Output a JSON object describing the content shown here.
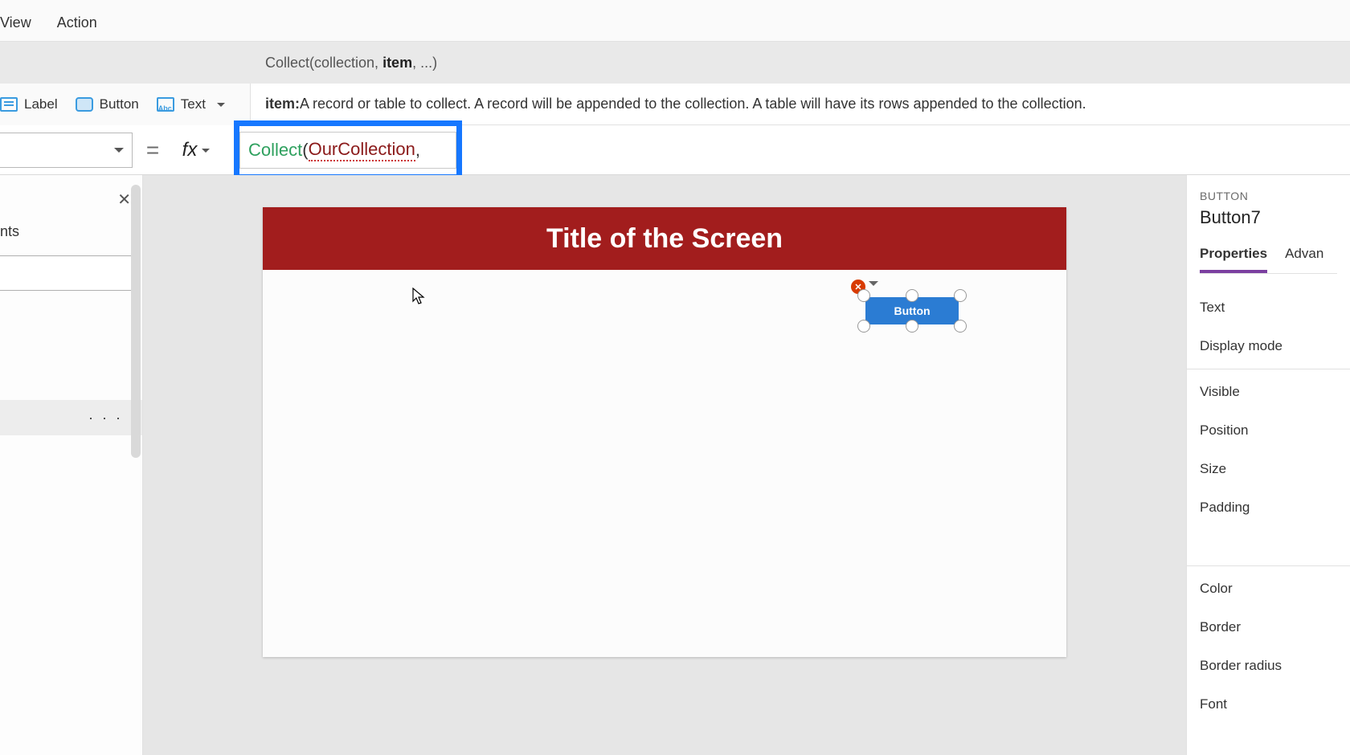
{
  "menubar": {
    "view": "View",
    "action": "Action"
  },
  "ribbon": {
    "label": "Label",
    "button": "Button",
    "text": "Text"
  },
  "intellisense": {
    "sig_pre": "Collect(collection, ",
    "sig_bold": "item",
    "sig_post": ", ...)",
    "param_name": "item:",
    "param_desc": " A record or table to collect. A record will be appended to the collection. A table will have its rows appended to the collection."
  },
  "formula": {
    "equals": "=",
    "fx": "fx",
    "fn": "Collect",
    "open": "(",
    "arg1": "OurCollection",
    "comma": ","
  },
  "treepanel": {
    "heading_fragment": "nts",
    "selected_more": "· · ·"
  },
  "canvas": {
    "screen_title": "Title of the Screen",
    "button_text": "Button"
  },
  "props": {
    "kind": "BUTTON",
    "name": "Button7",
    "tab_properties": "Properties",
    "tab_advanced": "Advan",
    "rows": {
      "text": "Text",
      "display_mode": "Display mode",
      "visible": "Visible",
      "position": "Position",
      "size": "Size",
      "padding": "Padding",
      "color": "Color",
      "border": "Border",
      "border_radius": "Border radius",
      "font": "Font"
    }
  }
}
